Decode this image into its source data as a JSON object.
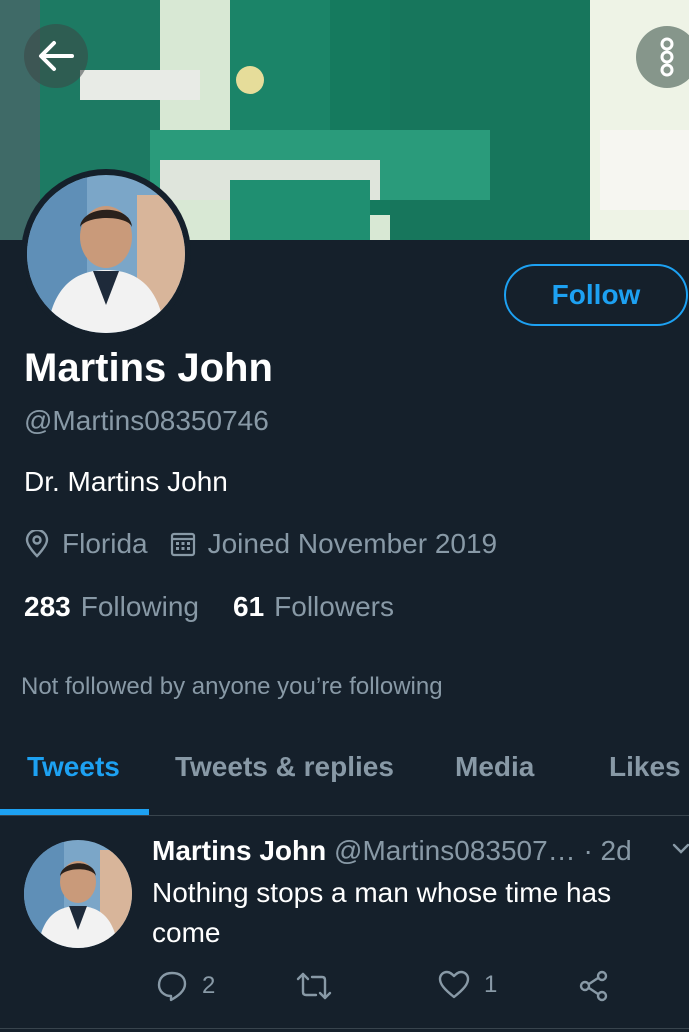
{
  "header": {
    "back_icon": "arrow-left-icon",
    "more_icon": "vertical-dots-icon"
  },
  "profile": {
    "name": "Martins John",
    "handle": "@Martins08350746",
    "bio": "Dr. Martins John",
    "location": "Florida",
    "joined": "Joined November 2019",
    "following_count": "283",
    "following_label": "Following",
    "followers_count": "61",
    "followers_label": "Followers",
    "not_followed": "Not followed by anyone you’re following",
    "follow_label": "Follow"
  },
  "tabs": [
    {
      "label": "Tweets",
      "active": true
    },
    {
      "label": "Tweets & replies",
      "active": false
    },
    {
      "label": "Media",
      "active": false
    },
    {
      "label": "Likes",
      "active": false
    }
  ],
  "tweet": {
    "name": "Martins John",
    "handle": "@Martins083507…",
    "time": "· 2d",
    "text": "Nothing stops a man whose time has come",
    "replies": "2",
    "retweets": "",
    "likes": "1"
  },
  "colors": {
    "background": "#15202b",
    "accent": "#1da1f2",
    "muted": "#8899a6"
  }
}
